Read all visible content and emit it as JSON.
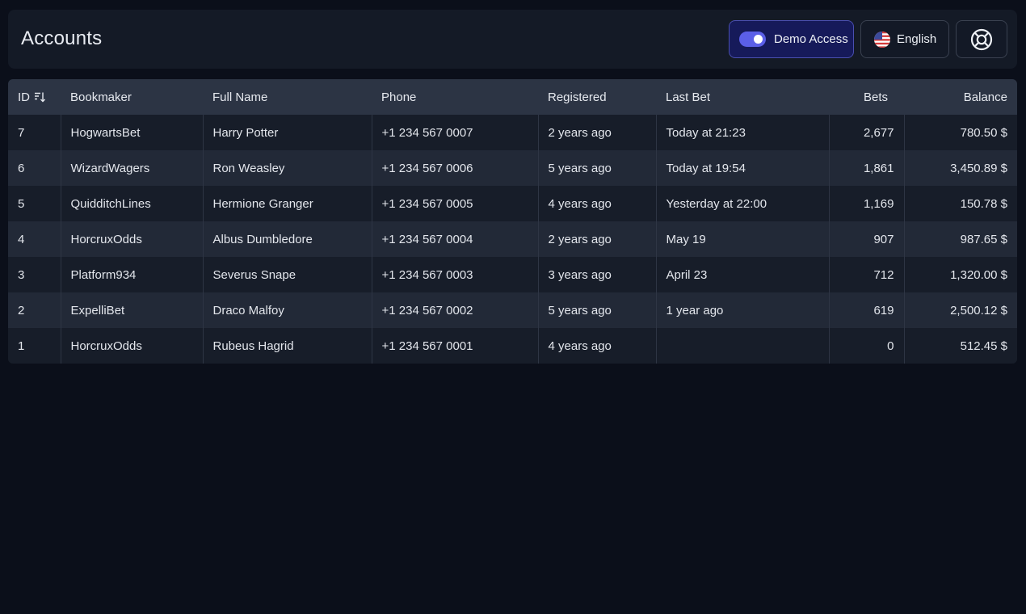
{
  "header": {
    "title": "Accounts",
    "demo_label": "Demo Access",
    "demo_enabled": true,
    "language_label": "English",
    "flag_icon": "us-flag-icon",
    "help_icon": "lifebuoy-icon"
  },
  "colors": {
    "background": "#0b0f1a",
    "accent": "#5b5fe8",
    "demo_button_bg": "#161a5a"
  },
  "table": {
    "columns": {
      "id": "ID",
      "bookmaker": "Bookmaker",
      "full_name": "Full Name",
      "phone": "Phone",
      "registered": "Registered",
      "last_bet": "Last Bet",
      "bets": "Bets",
      "balance": "Balance"
    },
    "sort_icon": "sort-descending-icon",
    "rows": [
      {
        "id": "7",
        "bookmaker": "HogwartsBet",
        "full_name": "Harry Potter",
        "phone": "+1 234 567 0007",
        "registered": "2 years ago",
        "last_bet": "Today at 21:23",
        "bets": "2,677",
        "balance": "780.50 $"
      },
      {
        "id": "6",
        "bookmaker": "WizardWagers",
        "full_name": "Ron Weasley",
        "phone": "+1 234 567 0006",
        "registered": "5 years ago",
        "last_bet": "Today at 19:54",
        "bets": "1,861",
        "balance": "3,450.89 $"
      },
      {
        "id": "5",
        "bookmaker": "QuidditchLines",
        "full_name": "Hermione Granger",
        "phone": "+1 234 567 0005",
        "registered": "4 years ago",
        "last_bet": "Yesterday at 22:00",
        "bets": "1,169",
        "balance": "150.78 $"
      },
      {
        "id": "4",
        "bookmaker": "HorcruxOdds",
        "full_name": "Albus Dumbledore",
        "phone": "+1 234 567 0004",
        "registered": "2 years ago",
        "last_bet": "May 19",
        "bets": "907",
        "balance": "987.65 $"
      },
      {
        "id": "3",
        "bookmaker": "Platform934",
        "full_name": "Severus Snape",
        "phone": "+1 234 567 0003",
        "registered": "3 years ago",
        "last_bet": "April 23",
        "bets": "712",
        "balance": "1,320.00 $"
      },
      {
        "id": "2",
        "bookmaker": "ExpelliBet",
        "full_name": "Draco Malfoy",
        "phone": "+1 234 567 0002",
        "registered": "5 years ago",
        "last_bet": "1 year ago",
        "bets": "619",
        "balance": "2,500.12 $"
      },
      {
        "id": "1",
        "bookmaker": "HorcruxOdds",
        "full_name": "Rubeus Hagrid",
        "phone": "+1 234 567 0001",
        "registered": "4 years ago",
        "last_bet": "",
        "bets": "0",
        "balance": "512.45 $"
      }
    ]
  }
}
